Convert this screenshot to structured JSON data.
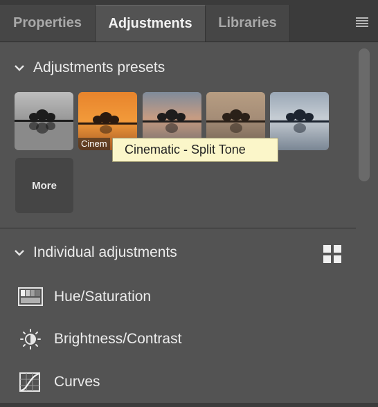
{
  "tabs": [
    {
      "label": "Properties",
      "active": false
    },
    {
      "label": "Adjustments",
      "active": true
    },
    {
      "label": "Libraries",
      "active": false
    }
  ],
  "icons": {
    "panel_menu": "hamburger-menu-icon",
    "section_toggle": "chevron-down-icon",
    "grid_view": "grid-view-icon",
    "hue_saturation": "hue-saturation-icon",
    "brightness_contrast": "brightness-contrast-icon",
    "curves": "curves-icon"
  },
  "presets": {
    "title": "Adjustments presets",
    "thumbnails": [
      {
        "caption": "",
        "tone": "grayscale"
      },
      {
        "caption": "Cinem",
        "tone": "orange-sunset"
      },
      {
        "caption": "",
        "tone": "warm-dusk"
      },
      {
        "caption": "",
        "tone": "sepia"
      },
      {
        "caption": "",
        "tone": "cool-blue"
      }
    ],
    "more_label": "More",
    "tooltip": "Cinematic - Split Tone"
  },
  "individual": {
    "title": "Individual adjustments",
    "items": [
      {
        "label": "Hue/Saturation"
      },
      {
        "label": "Brightness/Contrast"
      },
      {
        "label": "Curves"
      }
    ]
  },
  "colors": {
    "panel_bg": "#535353",
    "tabbar_bg": "#3b3b3b",
    "tooltip_bg": "#fbf6c9"
  }
}
